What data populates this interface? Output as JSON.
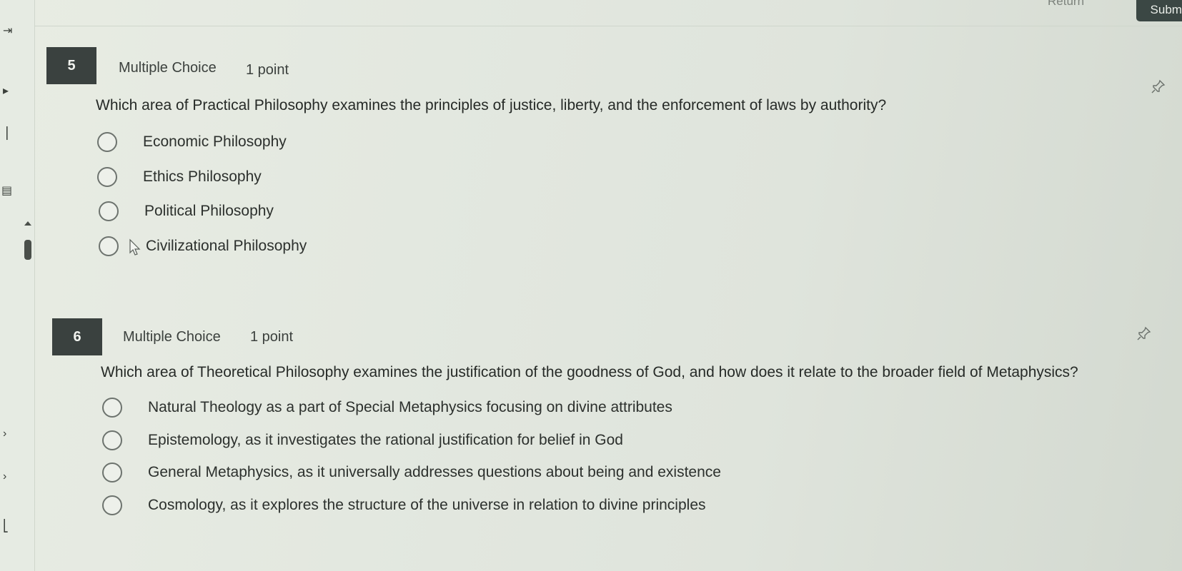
{
  "topbar": {
    "return_label": "Return",
    "submit_label": "Submit"
  },
  "questions": [
    {
      "number": "5",
      "type": "Multiple Choice",
      "points": "1 point",
      "text": "Which area of Practical Philosophy examines the principles of justice, liberty, and the enforcement of laws by authority?",
      "options": [
        "Economic Philosophy",
        "Ethics Philosophy",
        "Political Philosophy",
        "Civilizational Philosophy"
      ]
    },
    {
      "number": "6",
      "type": "Multiple Choice",
      "points": "1 point",
      "text": "Which area of Theoretical Philosophy examines the justification of the goodness of God, and how does it relate to the broader field of Metaphysics?",
      "options": [
        "Natural Theology as a part of Special Metaphysics focusing on divine attributes",
        "Epistemology, as it investigates the rational justification for belief in God",
        "General Metaphysics, as it universally addresses questions about being and existence",
        "Cosmology, as it explores the structure of the universe in relation to divine principles"
      ]
    }
  ],
  "icons": {
    "pin": "pin-icon",
    "cursor": "mouse-cursor-icon",
    "collapse": "collapse-sidebar-icon"
  }
}
